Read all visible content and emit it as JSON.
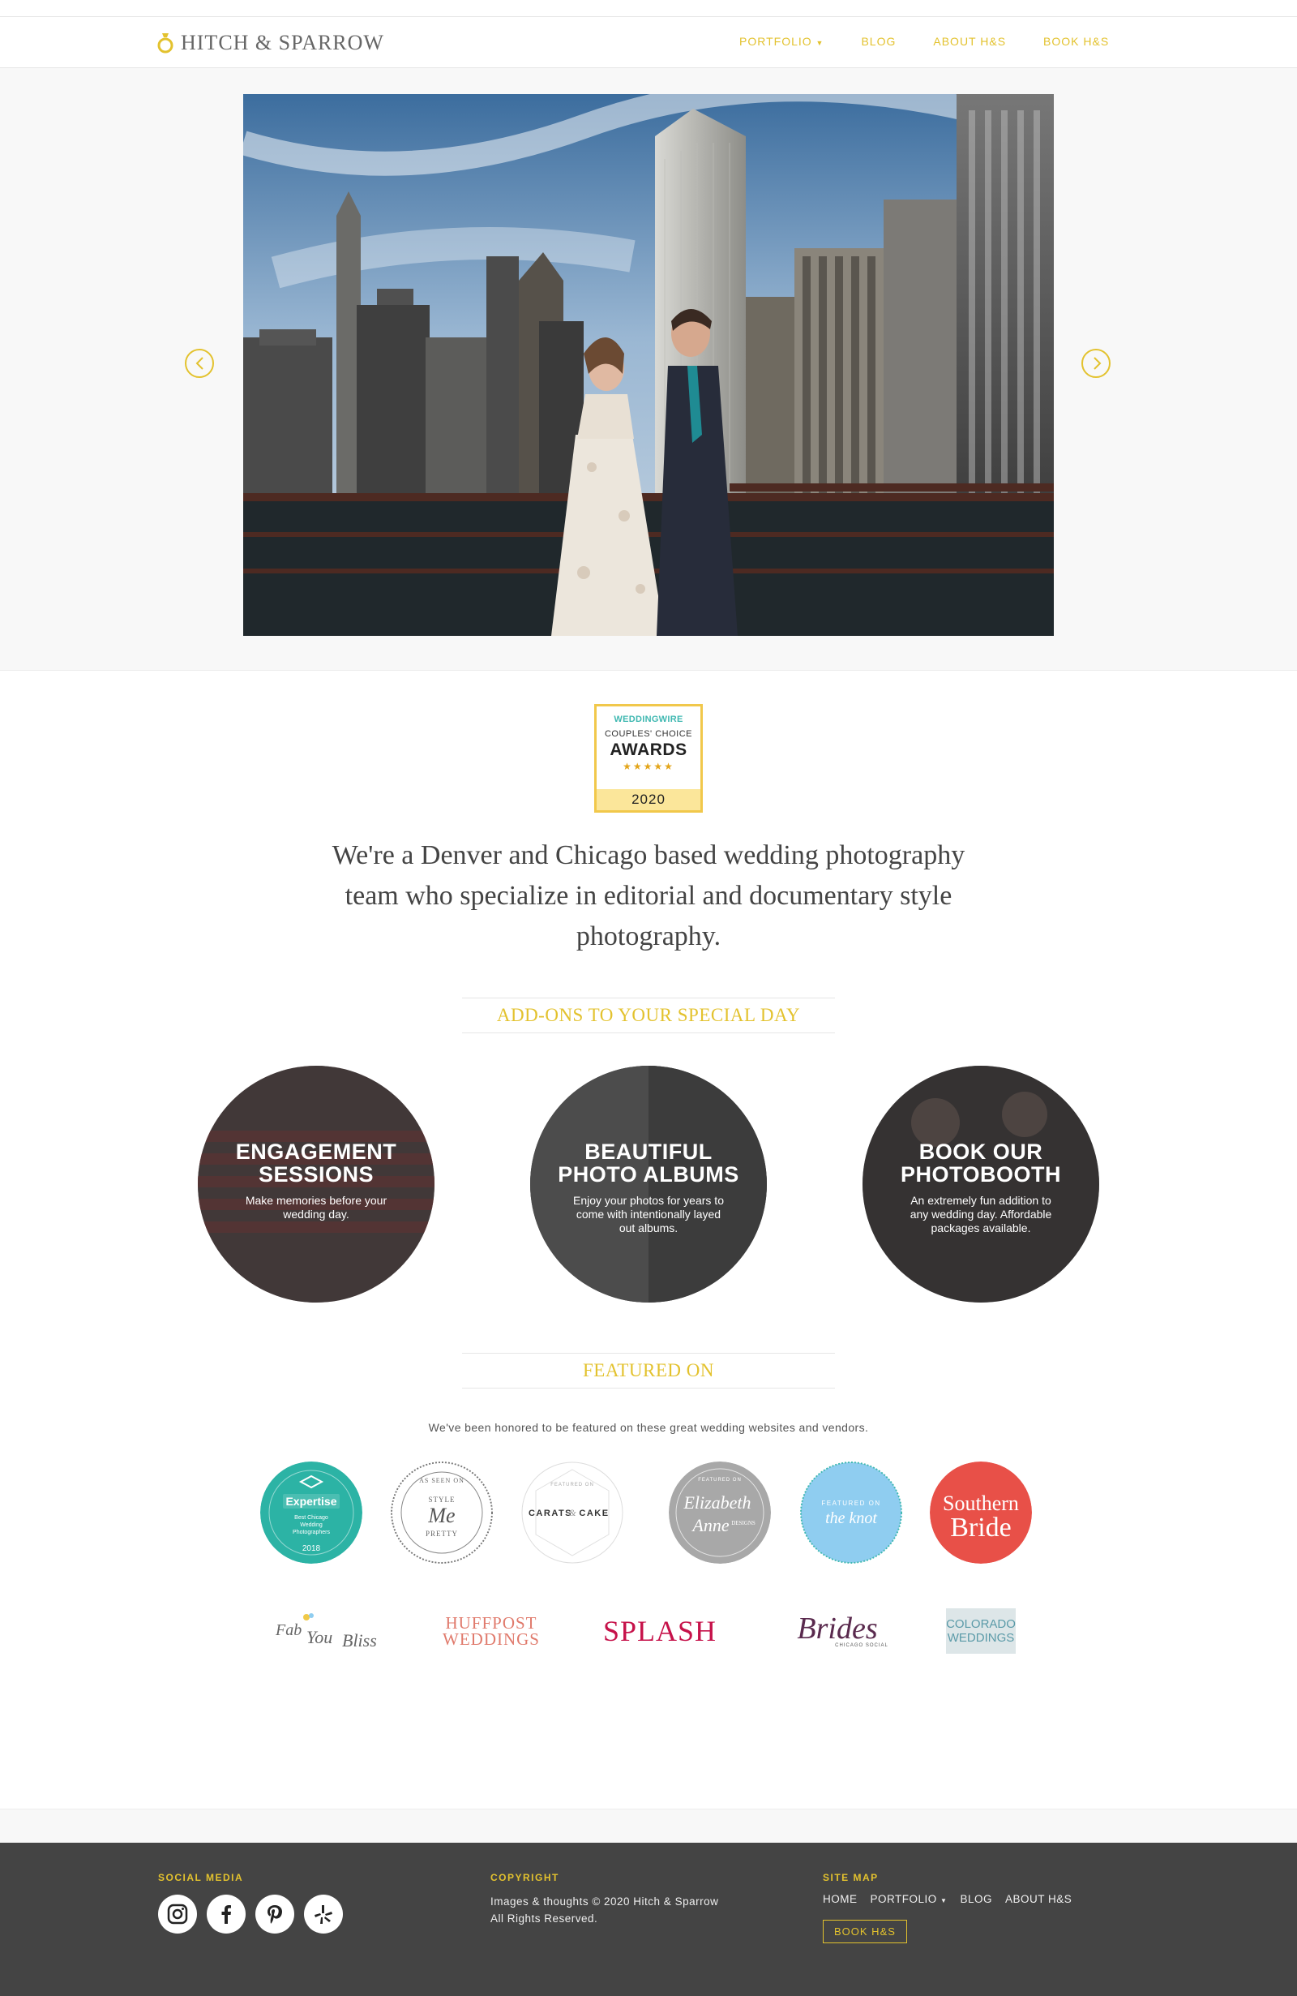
{
  "brand": {
    "logo_text": "HITCH & SPARROW",
    "accent": "#e3c22e"
  },
  "nav": {
    "items": [
      {
        "label": "PORTFOLIO",
        "has_caret": true
      },
      {
        "label": "BLOG"
      },
      {
        "label": "ABOUT H&S"
      },
      {
        "label": "BOOK H&S"
      }
    ]
  },
  "hero": {
    "image": "couple-city-river-photo",
    "prev_icon": "chevron-left-icon",
    "next_icon": "chevron-right-icon"
  },
  "award": {
    "brand": "WEDDINGWIRE",
    "subtitle": "COUPLES' CHOICE",
    "title": "AWARDS",
    "stars": "★★★★★",
    "year": "2020"
  },
  "intro": "We're a Denver and Chicago based wedding photography team who specialize in editorial and documentary style photography.",
  "addons": {
    "title": "ADD-ONS TO YOUR SPECIAL DAY",
    "items": [
      {
        "title_line1": "ENGAGEMENT",
        "title_line2": "SESSIONS",
        "desc": "Make memories before your wedding day."
      },
      {
        "title_line1": "BEAUTIFUL",
        "title_line2": "PHOTO ALBUMS",
        "desc": "Enjoy your photos for years to come with intentionally layed out albums."
      },
      {
        "title_line1": "BOOK OUR",
        "title_line2": "PHOTOBOOTH",
        "desc": "An extremely fun addition to any wedding day. Affordable packages available."
      }
    ]
  },
  "featured": {
    "title": "FEATURED ON",
    "desc": "We've been honored to be featured on these great wedding websites and vendors.",
    "badges": {
      "expertise": {
        "title": "Expertise",
        "line1": "Best Chicago",
        "line2": "Wedding",
        "line3": "Photographers",
        "year": "2018"
      },
      "stylemepretty": {
        "top": "AS SEEN ON",
        "mid": "STYLE",
        "me": "Me",
        "bottom": "PRETTY"
      },
      "caratscake": {
        "text": "CARATS",
        "amp": "&",
        "text2": "CAKE",
        "top": "FEATURED ON"
      },
      "elizabethanne": {
        "top": "FEATURED ON",
        "line1": "Elizabeth",
        "line2": "Anne",
        "small": "DESIGNS"
      },
      "theknot": {
        "top": "FEATURED ON",
        "text": "the knot"
      },
      "southernbride": {
        "line1": "Southern",
        "line2": "Bride"
      }
    },
    "vendors": {
      "fabyoubliss": {
        "line1": "Fab",
        "line2": "You",
        "line3": "Bliss"
      },
      "huffpost": {
        "line1": "HUFFPOST",
        "line2": "WEDDINGS"
      },
      "splash": {
        "text": "SPLASH"
      },
      "brides": {
        "text": "Brides",
        "small": "CHICAGO SOCIAL"
      },
      "colorado": {
        "line1": "COLORADO",
        "line2": "WEDDINGS"
      }
    }
  },
  "footer": {
    "social": {
      "heading": "SOCIAL MEDIA",
      "icons": [
        "instagram-icon",
        "facebook-icon",
        "pinterest-icon",
        "yelp-icon"
      ]
    },
    "copyright": {
      "heading": "COPYRIGHT",
      "line1": "Images & thoughts © 2020 Hitch & Sparrow",
      "line2": "All Rights Reserved."
    },
    "sitemap": {
      "heading": "SITE MAP",
      "items": [
        "HOME",
        "PORTFOLIO",
        "BLOG",
        "ABOUT H&S"
      ],
      "button": "BOOK H&S"
    }
  }
}
